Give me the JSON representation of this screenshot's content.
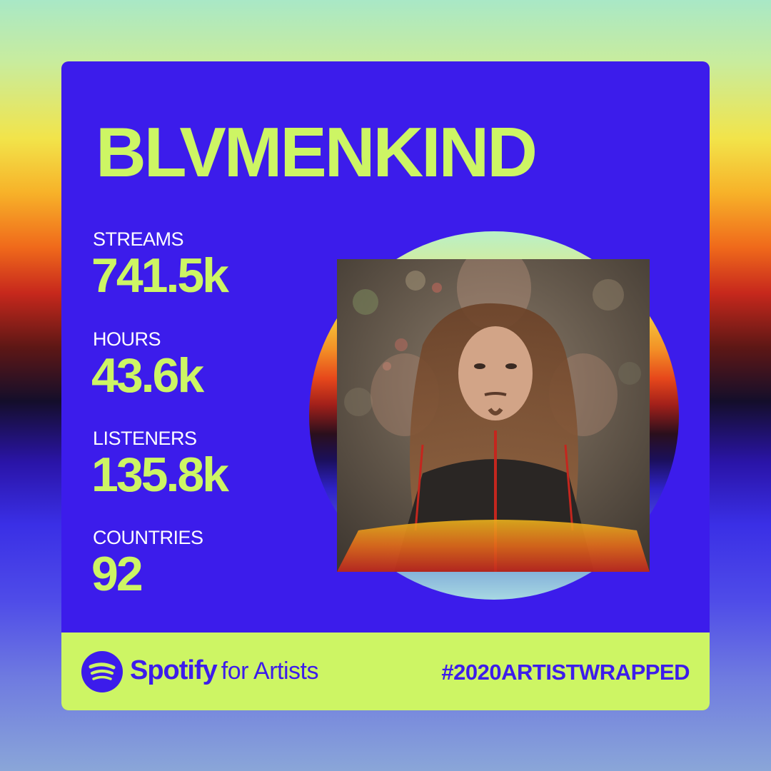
{
  "card": {
    "artist_name": "BLVMENKIND",
    "stats": [
      {
        "label": "STREAMS",
        "value": "741.5k"
      },
      {
        "label": "HOURS",
        "value": "43.6k"
      },
      {
        "label": "LISTENERS",
        "value": "135.8k"
      },
      {
        "label": "COUNTRIES",
        "value": "92"
      }
    ]
  },
  "footer": {
    "brand_name": "Spotify",
    "brand_suffix": "for Artists",
    "hashtag": "#2020ARTISTWRAPPED"
  },
  "colors": {
    "card_background": "#3c1ceb",
    "accent_lime": "#cdf564",
    "label_white": "#ffffff"
  },
  "icons": {
    "logo": "spotify-logo-icon"
  }
}
